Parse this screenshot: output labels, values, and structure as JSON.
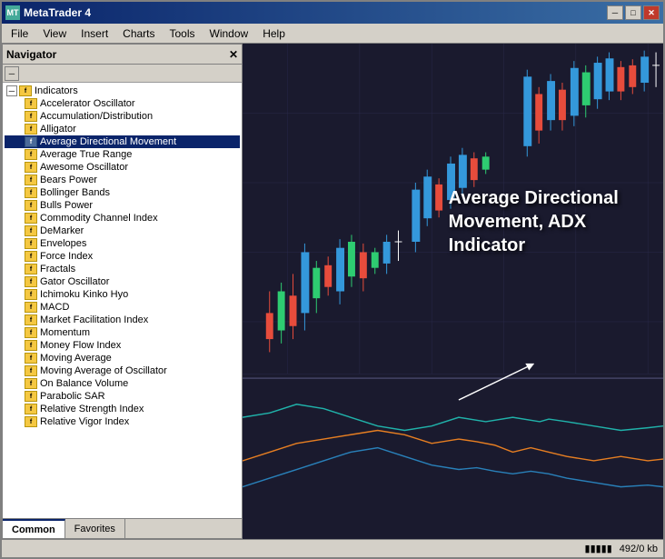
{
  "window": {
    "title": "MetaTrader 4",
    "title_icon": "MT"
  },
  "menu": {
    "items": [
      "File",
      "View",
      "Insert",
      "Charts",
      "Tools",
      "Window",
      "Help"
    ]
  },
  "navigator": {
    "title": "Navigator",
    "root_label": "Indicators",
    "indicators": [
      "Accelerator Oscillator",
      "Accumulation/Distribution",
      "Alligator",
      "Average Directional Movement",
      "Average True Range",
      "Awesome Oscillator",
      "Bears Power",
      "Bollinger Bands",
      "Bulls Power",
      "Commodity Channel Index",
      "DeMarker",
      "Envelopes",
      "Force Index",
      "Fractals",
      "Gator Oscillator",
      "Ichimoku Kinko Hyo",
      "MACD",
      "Market Facilitation Index",
      "Momentum",
      "Money Flow Index",
      "Moving Average",
      "Moving Average of Oscillator",
      "On Balance Volume",
      "Parabolic SAR",
      "Relative Strength Index",
      "Relative Vigor Index"
    ],
    "tabs": [
      "Common",
      "Favorites"
    ]
  },
  "chart": {
    "adx_label_line1": "Average Directional",
    "adx_label_line2": "Movement, ADX",
    "adx_label_line3": "Indicator"
  },
  "status_bar": {
    "chart_icon": "▮▮▮▮▮",
    "info": "492/0 kb"
  }
}
